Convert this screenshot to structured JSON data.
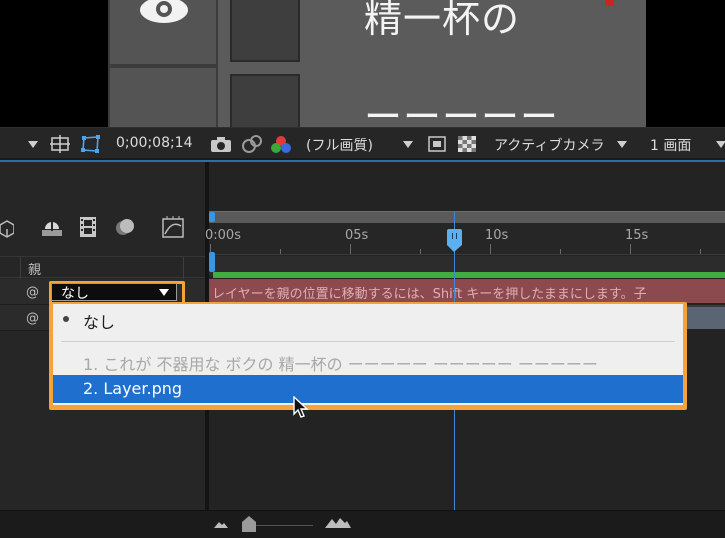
{
  "viewer": {
    "comp_text_1": "精一杯の",
    "comp_text_2": "ーーーーー"
  },
  "toolbar": {
    "timecode": "0;00;08;14",
    "resolution": "(フル画質)",
    "camera": "アクティブカメラ",
    "view": "1 画面",
    "icons": [
      "grid-icon",
      "safe-area-icon",
      "mask-path-icon",
      "camera-snapshot-icon",
      "show-snapshot-icon",
      "channel-rgb-icon",
      "region-of-interest-icon",
      "transparency-grid-icon"
    ]
  },
  "timeline": {
    "columns": {
      "parent": "親"
    },
    "icons": [
      "3d-layer-icon",
      "draft-3d-icon",
      "frame-blending-icon",
      "motion-blur-icon",
      "graph-editor-icon"
    ],
    "ruler": {
      "labels": [
        "0:00s",
        "05s",
        "10s",
        "15s"
      ]
    },
    "message": "レイヤーを親の位置に移動するには、Shift キーを押したままにします。子",
    "current_time_label": "08;14"
  },
  "parent_select": {
    "value": "なし"
  },
  "menu": {
    "items": [
      {
        "label": "なし",
        "state": "selected"
      },
      {
        "label": "1. これが 不器用な ボクの 精一杯の ーーーーー ーーーーー ーーーーー",
        "state": "disabled"
      },
      {
        "label": "2. Layer.png",
        "state": "highlighted"
      }
    ]
  },
  "colors": {
    "accent_orange": "#f6a33a",
    "highlight_blue": "#1f6fcf",
    "cti_blue": "#5ab0f0",
    "work_area_green": "#3fae3f"
  }
}
